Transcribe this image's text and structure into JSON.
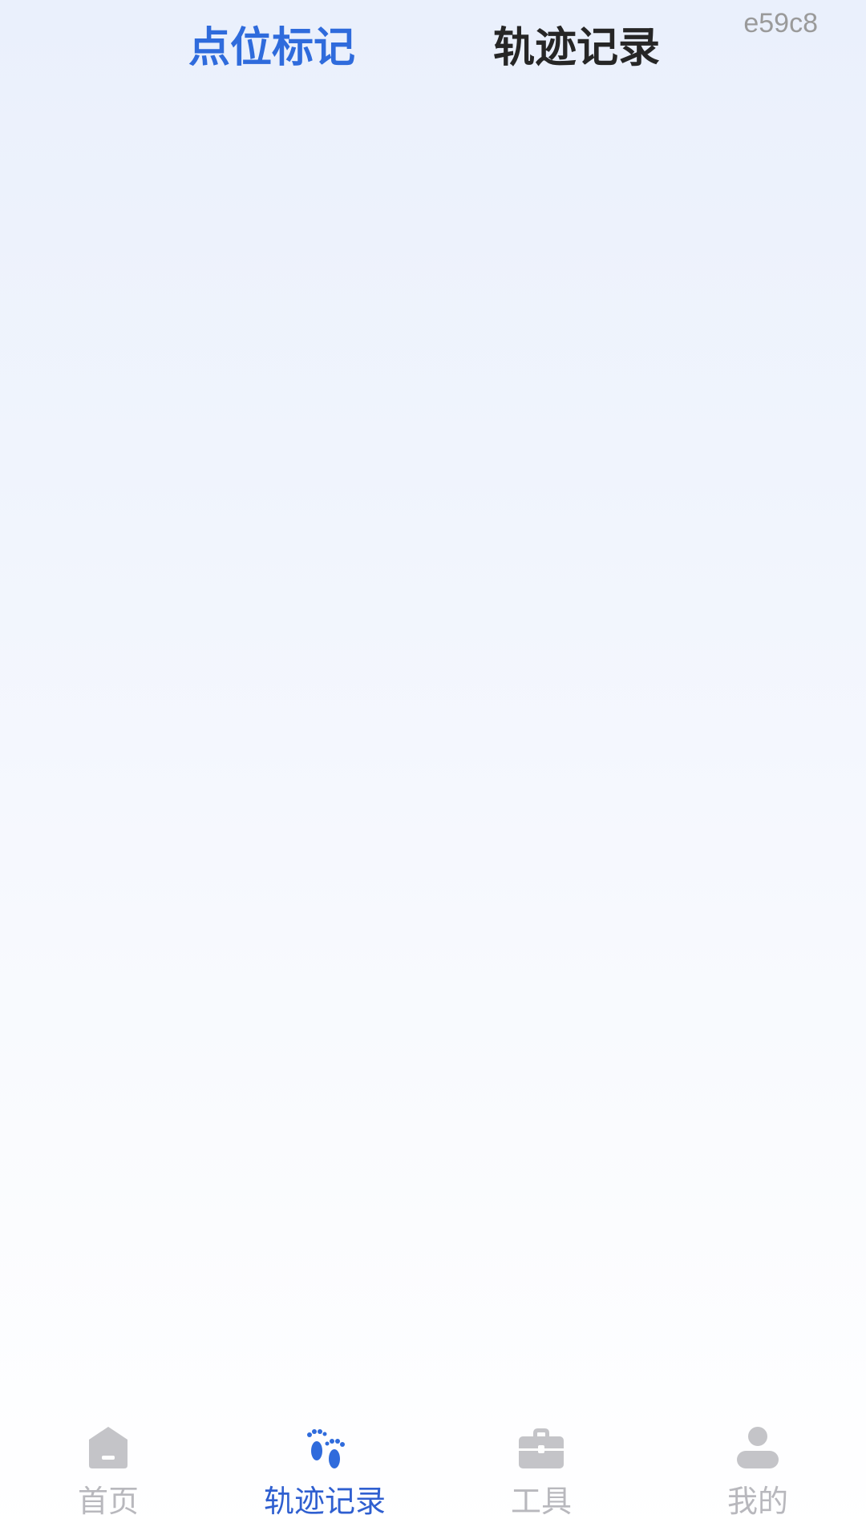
{
  "top_tabs": {
    "markers": "点位标记",
    "tracks": "轨迹记录",
    "active": "markers"
  },
  "corner_code": "e59c8",
  "bottom_nav": {
    "items": [
      {
        "label": "首页",
        "icon": "home-icon",
        "active": false
      },
      {
        "label": "轨迹记录",
        "icon": "footprints-icon",
        "active": true
      },
      {
        "label": "工具",
        "icon": "toolbox-icon",
        "active": false
      },
      {
        "label": "我的",
        "icon": "person-icon",
        "active": false
      }
    ]
  },
  "colors": {
    "accent": "#2f6bdc",
    "inactive_nav": "#b8b8bd",
    "icon_gray": "#c4c4c8"
  }
}
